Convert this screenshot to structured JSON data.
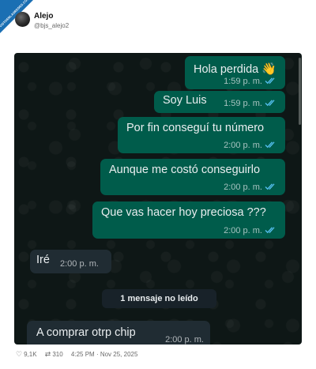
{
  "badge": {
    "text": "VISTOENLASREDES.COM"
  },
  "post": {
    "author_name": "Alejo",
    "author_handle": "@bjs_alejo2"
  },
  "chat": {
    "colors": {
      "outgoing": "#005c4b",
      "incoming": "#202c33",
      "background": "#0e1716",
      "ticks": "#53bdeb"
    },
    "messages": [
      {
        "text": "Hola perdida",
        "emoji": "👋",
        "time": "1:59 p. m.",
        "direction": "out",
        "status": "read"
      },
      {
        "text": "Soy Luis",
        "time": "1:59 p. m.",
        "direction": "out",
        "status": "read"
      },
      {
        "text": "Por fin conseguí tu número",
        "time": "2:00 p. m.",
        "direction": "out",
        "status": "read"
      },
      {
        "text": "Aunque me costó conseguirlo",
        "time": "2:00 p. m.",
        "direction": "out",
        "status": "read"
      },
      {
        "text": "Que vas hacer hoy preciosa ???",
        "time": "2:00 p. m.",
        "direction": "out",
        "status": "read"
      },
      {
        "text": "Iré",
        "time": "2:00 p. m.",
        "direction": "in"
      },
      {
        "text": "A comprar otrp chip",
        "time": "2:00 p. m.",
        "direction": "in"
      }
    ],
    "unread_divider": "1 mensaje no leído"
  },
  "footer": {
    "likes": "9,1K",
    "retweets": "310",
    "timestamp": "4:25 PM · Nov 25, 2025"
  }
}
